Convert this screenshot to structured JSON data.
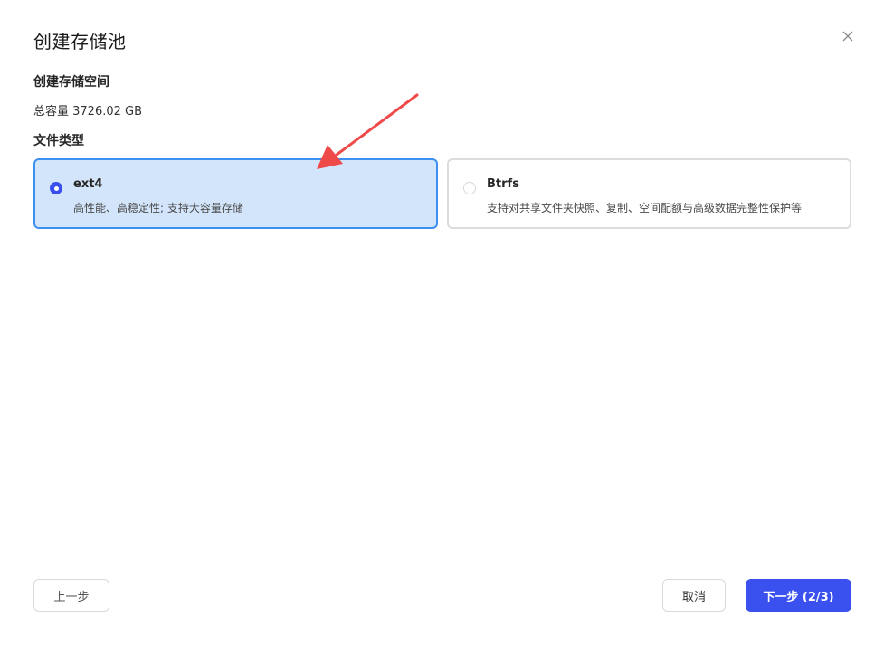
{
  "dialog": {
    "title": "创建存储池",
    "close_icon": "close-icon"
  },
  "storage_space": {
    "label": "创建存储空间",
    "capacity": "总容量 3726.02 GB"
  },
  "file_type": {
    "label": "文件类型",
    "selected": "ext4",
    "options": [
      {
        "name": "ext4",
        "description": "高性能、高稳定性; 支持大容量存储",
        "checked": true
      },
      {
        "name": "Btrfs",
        "description": "支持对共享文件夹快照、复制、空间配额与高级数据完整性保护等",
        "checked": false
      }
    ]
  },
  "footer": {
    "prev_label": "上一步",
    "cancel_label": "取消",
    "next_label": "下一步 (2/3)"
  },
  "colors": {
    "accent": "#3a50ef",
    "selected_card_bg": "#d3e5fb",
    "selected_card_border": "#3d8ff0",
    "annotation_arrow": "#ef4a4a"
  }
}
